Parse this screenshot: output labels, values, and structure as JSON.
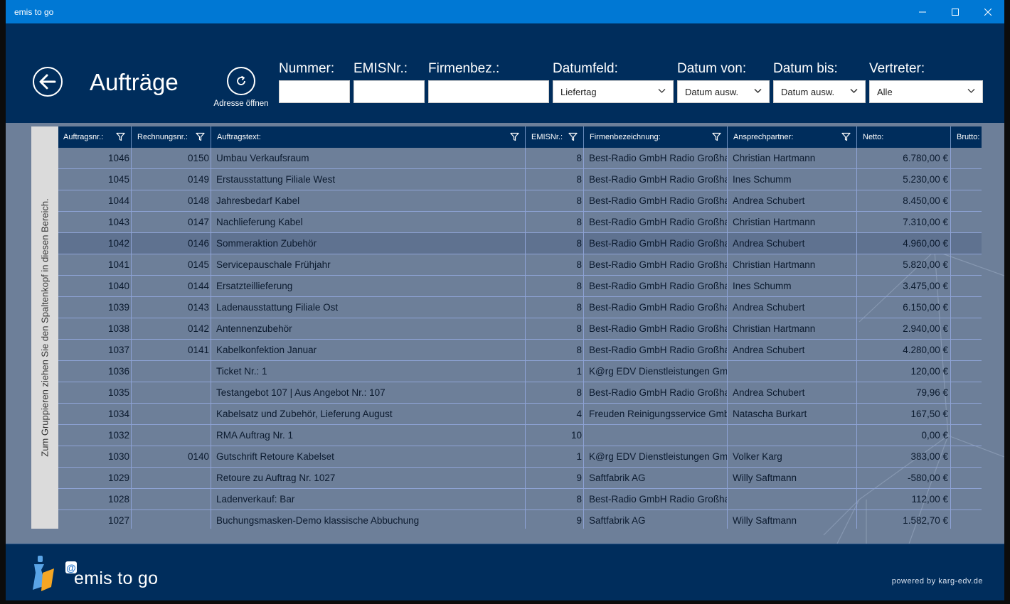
{
  "window": {
    "title": "emis to go"
  },
  "header": {
    "page_title": "Aufträge",
    "refresh_label": "Adresse öffnen"
  },
  "filters": {
    "nummer": {
      "label": "Nummer:",
      "value": ""
    },
    "emisnr": {
      "label": "EMISNr.:",
      "value": ""
    },
    "firmenbez": {
      "label": "Firmenbez.:",
      "value": ""
    },
    "datumfeld": {
      "label": "Datumfeld:",
      "value": "Liefertag"
    },
    "datum_von": {
      "label": "Datum von:",
      "value": "Datum ausw."
    },
    "datum_bis": {
      "label": "Datum bis:",
      "value": "Datum ausw."
    },
    "vertreter": {
      "label": "Vertreter:",
      "value": "Alle"
    }
  },
  "group_panel": {
    "text": "Zum Gruppieren ziehen Sie den Spaltenkopf in diesen Bereich."
  },
  "table": {
    "columns": [
      {
        "key": "auftragsnr",
        "label": "Auftragsnr.:",
        "filter": true
      },
      {
        "key": "rechnungsnr",
        "label": "Rechnungsnr.:",
        "filter": true
      },
      {
        "key": "auftragstext",
        "label": "Auftragstext:",
        "filter": true
      },
      {
        "key": "emisnr",
        "label": "EMISNr.:",
        "filter": true
      },
      {
        "key": "firma",
        "label": "Firmenbezeichnung:",
        "filter": true
      },
      {
        "key": "ansprech",
        "label": "Ansprechpartner:",
        "filter": true
      },
      {
        "key": "netto",
        "label": "Netto:",
        "filter": false
      },
      {
        "key": "brutto",
        "label": "Brutto:",
        "filter": false
      }
    ],
    "selected_row": 4,
    "rows": [
      {
        "auftragsnr": "1046",
        "rechnungsnr": "0150",
        "auftragstext": "Umbau Verkaufsraum",
        "emisnr": "8",
        "firma": "Best-Radio GmbH Radio Großhandel",
        "ansprech": "Christian Hartmann",
        "netto": "6.780,00 €",
        "brutto": ""
      },
      {
        "auftragsnr": "1045",
        "rechnungsnr": "0149",
        "auftragstext": "Erstausstattung Filiale West",
        "emisnr": "8",
        "firma": "Best-Radio GmbH Radio Großhandel",
        "ansprech": "Ines Schumm",
        "netto": "5.230,00 €",
        "brutto": ""
      },
      {
        "auftragsnr": "1044",
        "rechnungsnr": "0148",
        "auftragstext": "Jahresbedarf Kabel",
        "emisnr": "8",
        "firma": "Best-Radio GmbH Radio Großhandel",
        "ansprech": "Andrea Schubert",
        "netto": "8.450,00 €",
        "brutto": ""
      },
      {
        "auftragsnr": "1043",
        "rechnungsnr": "0147",
        "auftragstext": "Nachlieferung Kabel",
        "emisnr": "8",
        "firma": "Best-Radio GmbH Radio Großhandel",
        "ansprech": "Christian Hartmann",
        "netto": "7.310,00 €",
        "brutto": ""
      },
      {
        "auftragsnr": "1042",
        "rechnungsnr": "0146",
        "auftragstext": "Sommeraktion Zubehör",
        "emisnr": "8",
        "firma": "Best-Radio GmbH Radio Großhandel",
        "ansprech": "Andrea Schubert",
        "netto": "4.960,00 €",
        "brutto": ""
      },
      {
        "auftragsnr": "1041",
        "rechnungsnr": "0145",
        "auftragstext": "Servicepauschale Frühjahr",
        "emisnr": "8",
        "firma": "Best-Radio GmbH Radio Großhandel",
        "ansprech": "Christian Hartmann",
        "netto": "5.820,00 €",
        "brutto": ""
      },
      {
        "auftragsnr": "1040",
        "rechnungsnr": "0144",
        "auftragstext": "Ersatzteillieferung",
        "emisnr": "8",
        "firma": "Best-Radio GmbH Radio Großhandel",
        "ansprech": "Ines Schumm",
        "netto": "3.475,00 €",
        "brutto": ""
      },
      {
        "auftragsnr": "1039",
        "rechnungsnr": "0143",
        "auftragstext": "Ladenausstattung Filiale Ost",
        "emisnr": "8",
        "firma": "Best-Radio GmbH Radio Großhandel",
        "ansprech": "Andrea Schubert",
        "netto": "6.150,00 €",
        "brutto": ""
      },
      {
        "auftragsnr": "1038",
        "rechnungsnr": "0142",
        "auftragstext": "Antennenzubehör",
        "emisnr": "8",
        "firma": "Best-Radio GmbH Radio Großhandel",
        "ansprech": "Christian Hartmann",
        "netto": "2.940,00 €",
        "brutto": ""
      },
      {
        "auftragsnr": "1037",
        "rechnungsnr": "0141",
        "auftragstext": "Kabelkonfektion Januar",
        "emisnr": "8",
        "firma": "Best-Radio GmbH Radio Großhandel",
        "ansprech": "Andrea Schubert",
        "netto": "4.280,00 €",
        "brutto": ""
      },
      {
        "auftragsnr": "1036",
        "rechnungsnr": "",
        "auftragstext": "Ticket Nr.: 1",
        "emisnr": "1",
        "firma": "K@rg EDV Dienstleistungen GmbH",
        "ansprech": "",
        "netto": "120,00 €",
        "brutto": ""
      },
      {
        "auftragsnr": "1035",
        "rechnungsnr": "",
        "auftragstext": "Testangebot 107 | Aus Angebot Nr.: 107",
        "emisnr": "8",
        "firma": "Best-Radio GmbH Radio Großhandel",
        "ansprech": "Andrea Schubert",
        "netto": "79,96 €",
        "brutto": ""
      },
      {
        "auftragsnr": "1034",
        "rechnungsnr": "",
        "auftragstext": "Kabelsatz und Zubehör, Lieferung August",
        "emisnr": "4",
        "firma": "Freuden Reinigungsservice GmbH",
        "ansprech": "Natascha Burkart",
        "netto": "167,50 €",
        "brutto": ""
      },
      {
        "auftragsnr": "1032",
        "rechnungsnr": "",
        "auftragstext": "RMA Auftrag Nr. 1",
        "emisnr": "10",
        "firma": "",
        "ansprech": "",
        "netto": "0,00 €",
        "brutto": ""
      },
      {
        "auftragsnr": "1030",
        "rechnungsnr": "0140",
        "auftragstext": "Gutschrift Retoure Kabelset",
        "emisnr": "1",
        "firma": "K@rg EDV Dienstleistungen GmbH",
        "ansprech": "Volker Karg",
        "netto": "383,00 €",
        "brutto": ""
      },
      {
        "auftragsnr": "1029",
        "rechnungsnr": "",
        "auftragstext": "Retoure zu Auftrag Nr. 1027",
        "emisnr": "9",
        "firma": "Saftfabrik AG",
        "ansprech": "Willy Saftmann",
        "netto": "-580,00 €",
        "brutto": ""
      },
      {
        "auftragsnr": "1028",
        "rechnungsnr": "",
        "auftragstext": "Ladenverkauf: Bar",
        "emisnr": "8",
        "firma": "Best-Radio GmbH Radio Großhandel",
        "ansprech": "",
        "netto": "112,00 €",
        "brutto": ""
      },
      {
        "auftragsnr": "1027",
        "rechnungsnr": "",
        "auftragstext": "Buchungsmasken-Demo klassische Abbuchung",
        "emisnr": "9",
        "firma": "Saftfabrik AG",
        "ansprech": "Willy Saftmann",
        "netto": "1.582,70 €",
        "brutto": ""
      }
    ]
  },
  "footer": {
    "brand": "emis to go",
    "powered_by": "powered by karg-edv.de"
  },
  "colors": {
    "titlebar": "#0078d4",
    "header_bg": "#002d5c",
    "grid_bg": "#6d7f99",
    "selected_row": "#5f7290",
    "grid_line": "#8ea3d6"
  }
}
